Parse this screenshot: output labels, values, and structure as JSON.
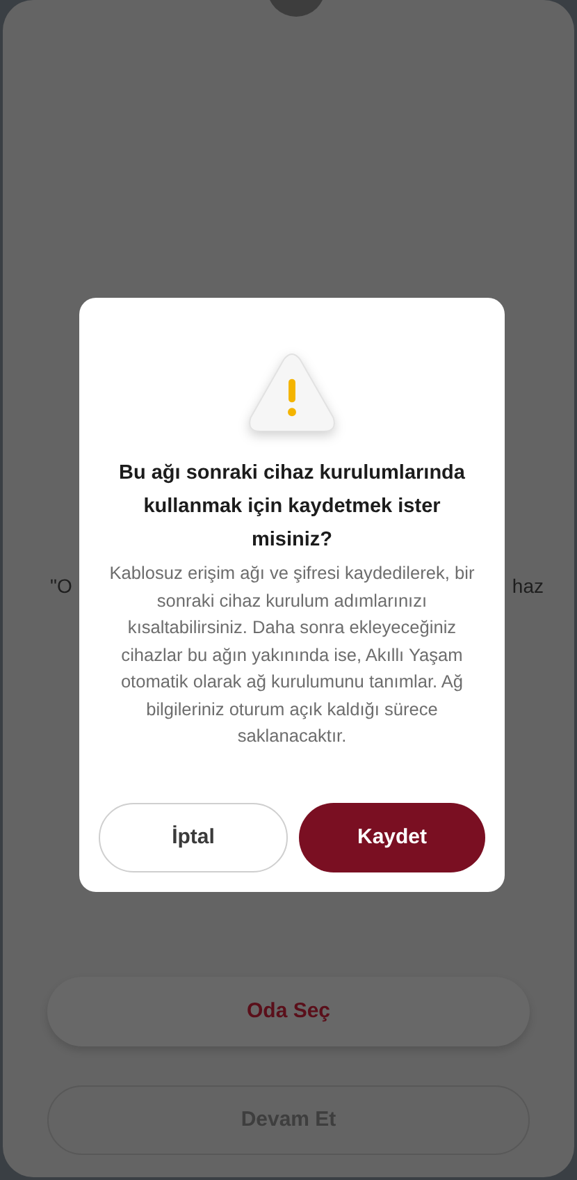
{
  "background_text": {
    "left_fragment": "\"O",
    "right_fragment": "haz"
  },
  "background_buttons": [
    {
      "label": "Oda Seç",
      "kind": "filled"
    },
    {
      "label": "Devam Et",
      "kind": "outlined"
    }
  ],
  "dialog": {
    "title": "Bu ağı sonraki cihaz kurulumlarında kullanmak için kaydetmek ister misiniz?",
    "message": "Kablosuz erişim ağı ve şifresi kaydedilerek, bir sonraki cihaz kurulum adımlarınızı kısaltabilirsiniz. Daha sonra ekleyeceğiniz cihazlar bu ağın yakınında ise, Akıllı Yaşam otomatik olarak ağ kurulumunu tanımlar. Ağ bilgileriniz oturum açık kaldığı sürece saklanacaktır.",
    "buttons": [
      {
        "label": "İptal",
        "kind": "secondary"
      },
      {
        "label": "Kaydet",
        "kind": "primary"
      }
    ]
  }
}
